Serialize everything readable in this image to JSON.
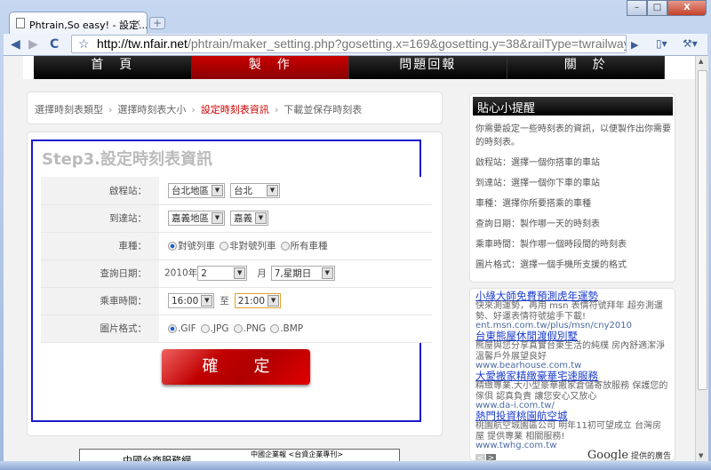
{
  "browser": {
    "tab_title": "Phtrain,So easy! - 設定...",
    "tab_close": "×",
    "new_tab": "+",
    "url_host": "http://tw.nfair.net",
    "url_rest": "/phtrain/maker_setting.php?gosetting.x=169&gosetting.y=38&railType=twrailway&imgSize",
    "window_controls": [
      "–",
      "□",
      "X"
    ],
    "icons": [
      "back-icon",
      "forward-icon",
      "reload-icon",
      "star-icon",
      "page-icon",
      "wrench-icon"
    ]
  },
  "nav": [
    "首　頁",
    "製　作",
    "問題回報",
    "關　於"
  ],
  "breadcrumb": [
    "選擇時刻表類型",
    "選擇時刻表大小",
    "設定時刻表資訊",
    "下載並保存時刻表"
  ],
  "breadcrumb_sep": "›",
  "form": {
    "title": "Step3.設定時刻表資訊",
    "rows": {
      "depart": {
        "label": "啟程站：",
        "region": "台北地區",
        "station": "台北"
      },
      "arrive": {
        "label": "到達站：",
        "region": "嘉義地區",
        "station": "嘉義"
      },
      "train": {
        "label": "車種：",
        "options": [
          "對號列車",
          "非對號列車",
          "所有車種"
        ],
        "selected": 0
      },
      "date": {
        "label": "查詢日期：",
        "year": "2010年",
        "month": "2",
        "month_unit": "月",
        "day": "7,星期日"
      },
      "time": {
        "label": "乘車時間：",
        "from": "16:00",
        "to_label": "至",
        "to": "21:00"
      },
      "format": {
        "label": "圖片格式：",
        "options": [
          ".GIF",
          ".JPG",
          ".PNG",
          ".BMP"
        ],
        "selected": 0
      }
    },
    "confirm": "確定"
  },
  "tips": {
    "title": "貼心小提醒",
    "lines": [
      "你需要設定一些時刻表的資訊，以便製作出你需要的時刻表。",
      "啟程站：選擇一個你搭車的車站",
      "到達站：選擇一個你下車的車站",
      "車種：選擇你所要搭乘的車種",
      "查詢日期：製作哪一天的時刻表",
      "乘車時間：製作哪一個時段間的時刻表",
      "圖片格式：選擇一個手機所支援的格式"
    ]
  },
  "ads": [
    {
      "title": "小綠大師免費預測虎年運勢",
      "desc": "快來測運勢，再用 msn 表情符號拜年 超夯測運勢、好運表情符號搶手下載!",
      "url": "ent.msn.com.tw/plus/msn/cny2010"
    },
    {
      "title": "台東熊屋休閒渡假別墅",
      "desc": "熊屋與您分享真實台東生活的純樸 房內舒適潔淨溫馨戶外展望良好",
      "url": "www.bearhouse.com.tw"
    },
    {
      "title": "大愛搬家精緻豪華宅速服務",
      "desc": "精緻專業.大小型豪華搬家倉儲寄放服務 保護您的傢俱 認真負責 讓您安心又放心",
      "url": "www.da-i.com.tw/"
    },
    {
      "title": "熱門投資桃園航空城",
      "desc": "桃園航空城園區公司 明年11初可望成立 台灣房屋 提供專業 相關服務!",
      "url": "www.twhg.com.tw"
    }
  ],
  "ads_footer": {
    "brand": "Google",
    "text": "提供的廣告",
    "prev": "<",
    "next": ">"
  },
  "bottom_ad": {
    "left": "中國台商服務網",
    "right": "中國企業報 <台資企業專刊>"
  }
}
